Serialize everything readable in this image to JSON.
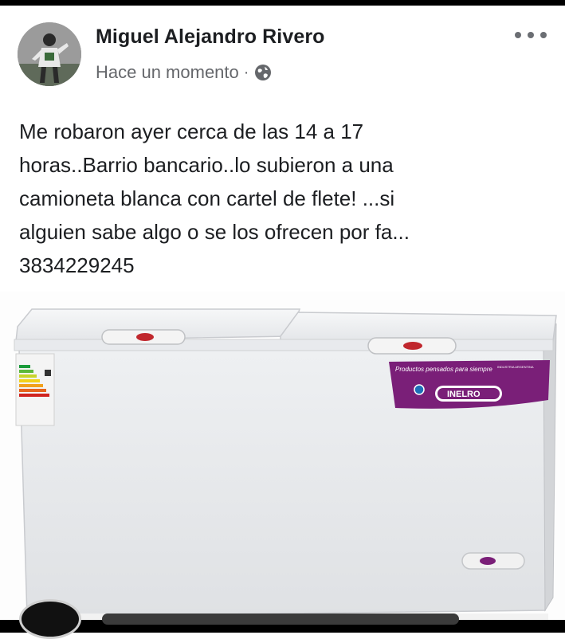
{
  "post": {
    "author": "Miguel Alejandro Rivero",
    "timestamp": "Hace un momento",
    "separator": "·",
    "audience_icon": "globe-icon",
    "more_icon": "more-options-icon",
    "text": "Me robaron ayer cerca de las 14 a 17\nhoras..Barrio bancario..lo subieron a una\ncamioneta blanca con cartel de flete! ...si\nalguien sabe algo o se los ofrecen por fa...\n3834229245"
  },
  "photo": {
    "subject": "chest-freezer",
    "lid_badge": "INELRO",
    "promo_tagline": "Productos pensados para siempre",
    "promo_brand": "INELRO",
    "promo_side": "INDUSTRIA ARGENTINA",
    "colors": {
      "body": "#e9eaec",
      "promo_purple": "#7a1f78",
      "badge_red": "#c0272d"
    }
  }
}
